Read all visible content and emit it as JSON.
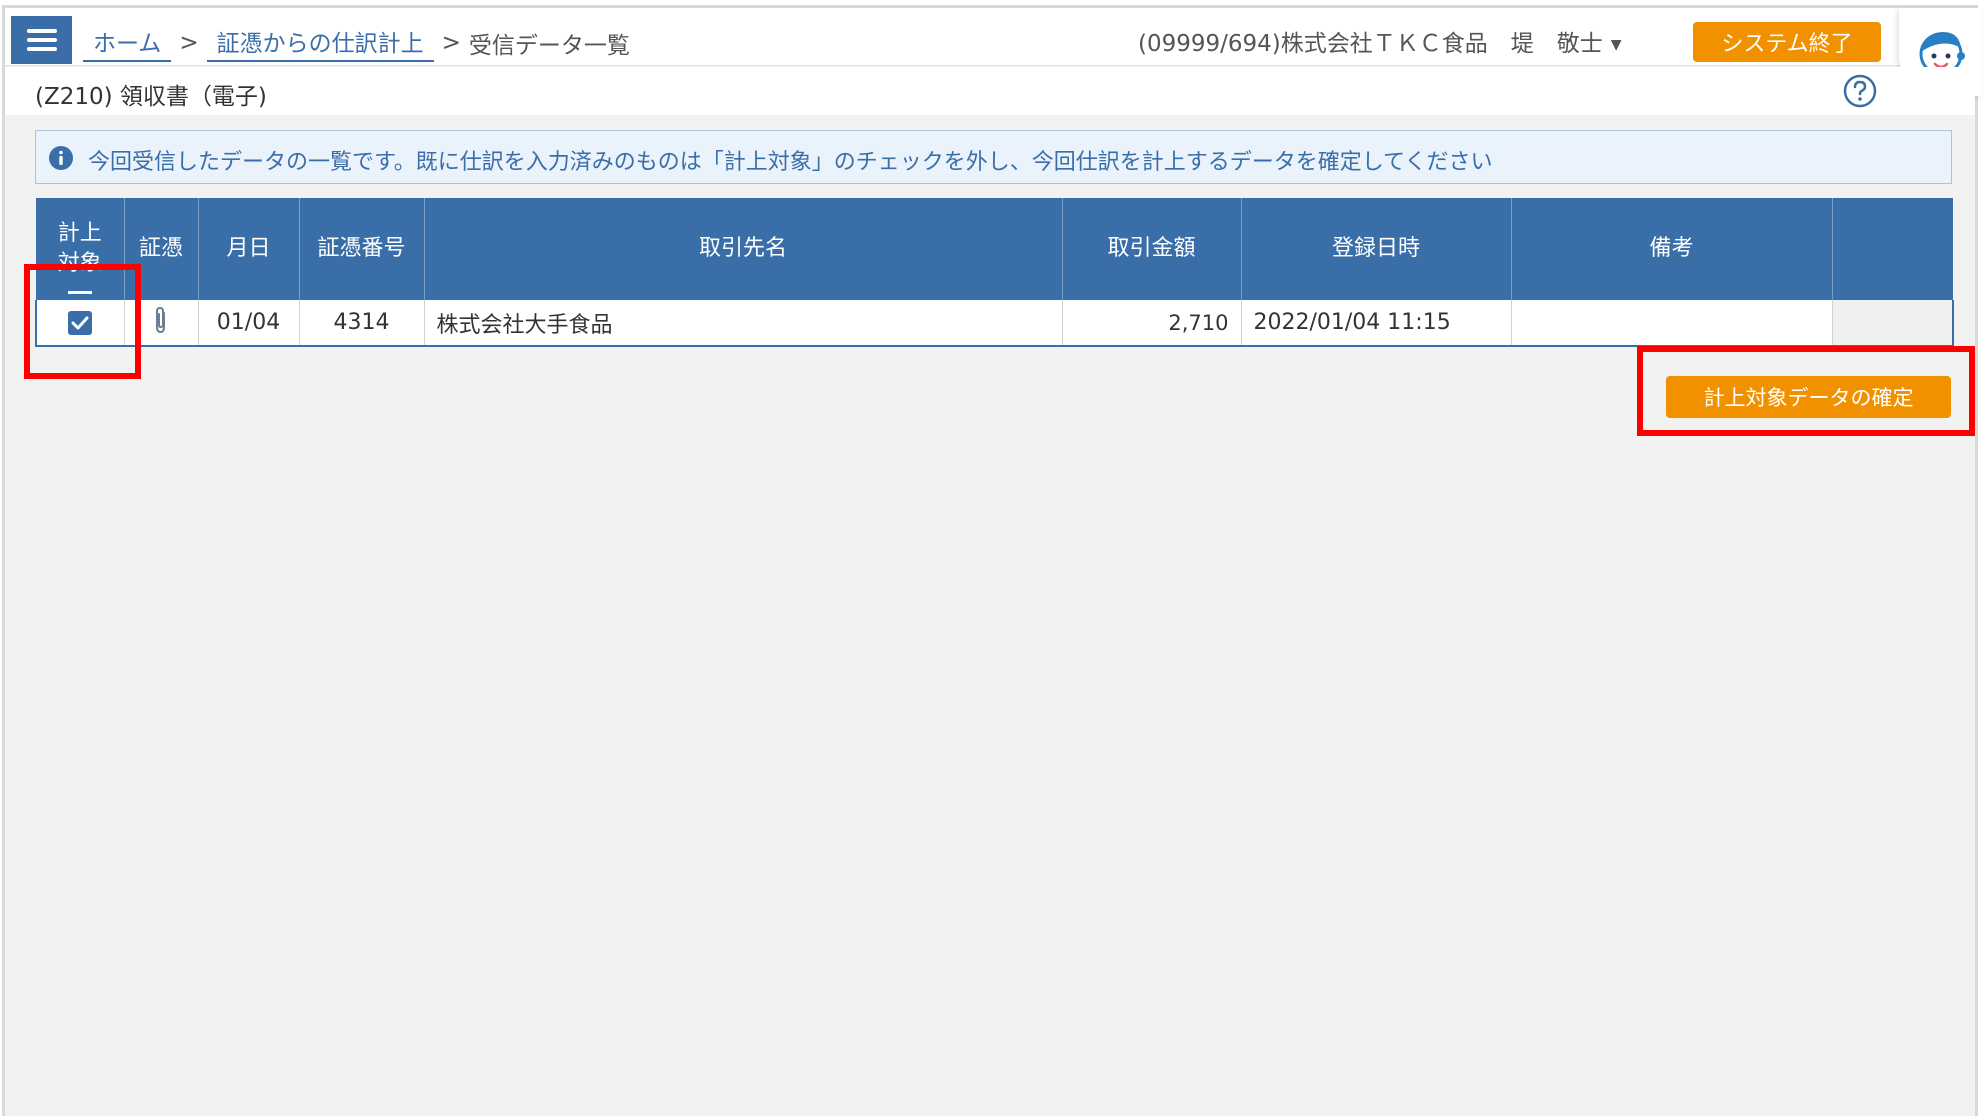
{
  "breadcrumb": {
    "home": "ホーム",
    "journal": "証憑からの仕訳計上",
    "current": "受信データ一覧",
    "separator": ">"
  },
  "user": {
    "label": "(09999/694)株式会社ＴＫＣ食品　堤　敬士",
    "caret": "▼"
  },
  "header": {
    "exit_label": "システム終了"
  },
  "page": {
    "title": "(Z210) 領収書（電子)"
  },
  "info": {
    "text": "今回受信したデータの一覧です。既に仕訳を入力済みのものは「計上対象」のチェックを外し、今回仕訳を計上するデータを確定してください"
  },
  "table": {
    "headers": {
      "target_line1": "計上",
      "target_line2": "対象",
      "voucher": "証憑",
      "date": "月日",
      "voucher_no": "証憑番号",
      "partner": "取引先名",
      "amount": "取引金額",
      "registered": "登録日時",
      "note": "備考"
    },
    "rows": [
      {
        "checked": true,
        "date": "01/04",
        "voucher_no": "4314",
        "partner": "株式会社大手食品",
        "amount": "2,710",
        "registered": "2022/01/04 11:15",
        "note": ""
      }
    ]
  },
  "actions": {
    "confirm_label": "計上対象データの確定"
  },
  "colors": {
    "primary": "#3a6ea8",
    "accent": "#f29100",
    "highlight": "#ff0000"
  }
}
